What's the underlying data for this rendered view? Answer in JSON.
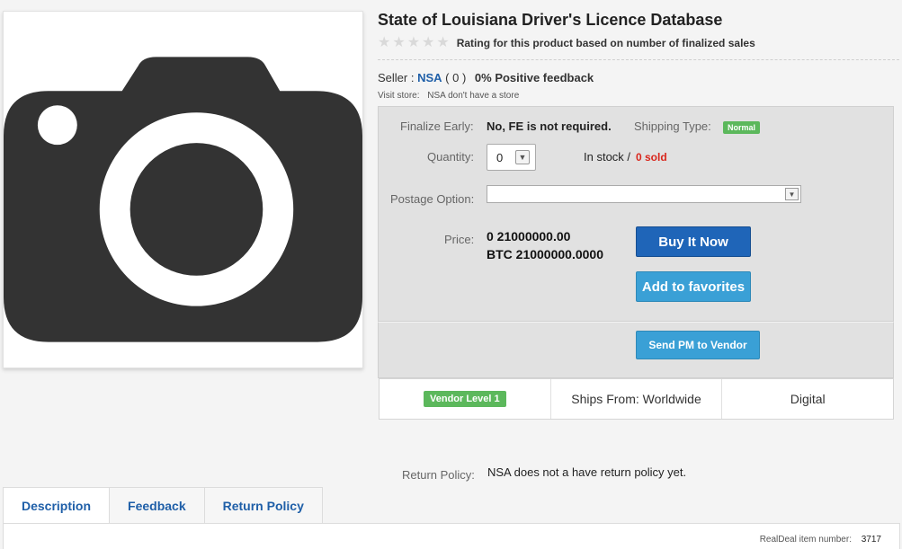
{
  "product": {
    "title": "State of Louisiana Driver's Licence Database",
    "rating_text": "Rating for this product based on number of finalized sales",
    "stars": 5
  },
  "seller": {
    "label": "Seller :",
    "name": "NSA",
    "count": "( 0 )",
    "feedback": "0% Positive feedback",
    "visit_label": "Visit store:",
    "visit_value": "NSA don't have a store"
  },
  "details": {
    "finalize_label": "Finalize Early:",
    "finalize_value": "No, FE is not required.",
    "shipping_label": "Shipping Type:",
    "shipping_badge": "Normal",
    "quantity_label": "Quantity:",
    "quantity_value": "0",
    "stock_text": "In stock /",
    "sold_text": "0 sold",
    "postage_label": "Postage Option:",
    "postage_value": "",
    "price_label": "Price:",
    "price_line1": "0 21000000.00",
    "price_line2": "BTC 21000000.0000"
  },
  "buttons": {
    "buy_now": "Buy It Now",
    "add_favorites": "Add to favorites",
    "send_pm": "Send PM to Vendor"
  },
  "meta": {
    "vendor_level": "Vendor Level 1",
    "ships_from": "Ships From: Worldwide",
    "type": "Digital"
  },
  "return_policy": {
    "label": "Return Policy:",
    "value": "NSA does not a have return policy yet."
  },
  "tabs": [
    {
      "label": "Description",
      "active": true
    },
    {
      "label": "Feedback",
      "active": false
    },
    {
      "label": "Return Policy",
      "active": false
    }
  ],
  "footer": {
    "item_label": "RealDeal item number:",
    "item_value": "3717"
  },
  "colors": {
    "link_blue": "#1f5fa8",
    "buy_blue": "#1f65b8",
    "light_blue": "#3aa0d6",
    "badge_green": "#5cb85c",
    "sold_red": "#d9261c"
  }
}
